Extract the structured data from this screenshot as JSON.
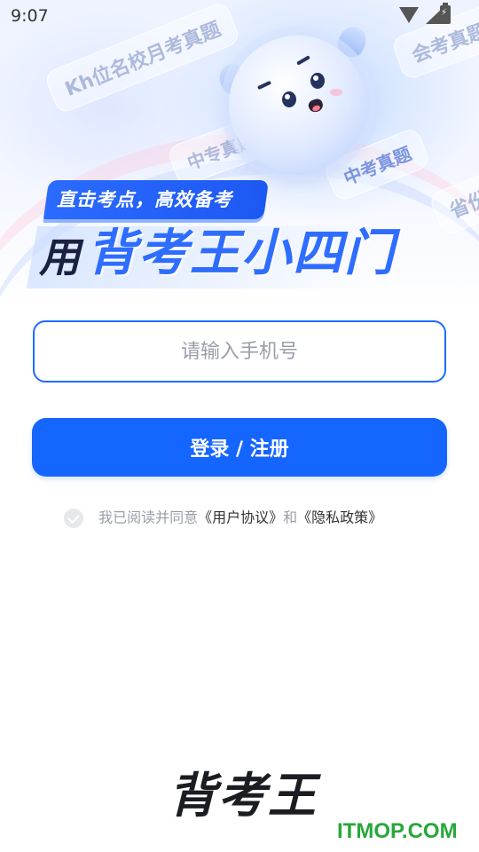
{
  "status_bar": {
    "time": "9:07",
    "icons": [
      "wifi-icon",
      "signal-icon",
      "battery-charging-icon"
    ]
  },
  "hero": {
    "tags": [
      "Kh位名校月考真题",
      "会考真题",
      "中专真题",
      "中考真题",
      "省份联"
    ],
    "slogan": "直击考点，高效备考",
    "headline_prefix": "用",
    "headline_main": "背考王小四门"
  },
  "login_form": {
    "phone_placeholder": "请输入手机号",
    "phone_value": "",
    "submit_label": "登录 / 注册",
    "agreement": {
      "checked": true,
      "prefix": "我已阅读并同意",
      "user_agreement": "《用户协议》",
      "conjunction": "和",
      "privacy_policy": "《隐私政策》"
    }
  },
  "footer": {
    "brand": "背考王",
    "watermark": "ITMOP.COM"
  },
  "colors": {
    "primary": "#1565ff",
    "input_border": "#1f6bff",
    "muted_text": "#9a9ea8",
    "watermark": "#27a83a"
  }
}
